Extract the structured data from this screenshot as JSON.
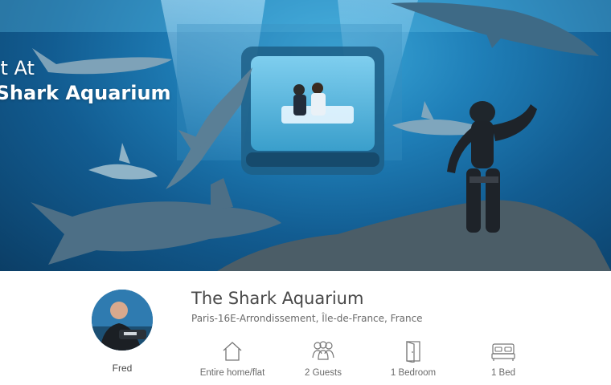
{
  "hero": {
    "title_line1": "ght At",
    "title_line2": "e Shark Aquarium"
  },
  "host": {
    "name": "Fred"
  },
  "listing": {
    "title": "The Shark Aquarium",
    "location": "Paris-16E-Arrondissement, Île-de-France, France"
  },
  "amenities": [
    {
      "icon": "house-icon",
      "label": "Entire home/flat"
    },
    {
      "icon": "guests-icon",
      "label": "2 Guests"
    },
    {
      "icon": "door-icon",
      "label": "1 Bedroom"
    },
    {
      "icon": "bed-icon",
      "label": "1 Bed"
    }
  ],
  "colors": {
    "water_light": "#3aa7d8",
    "water_dark": "#0b3e66",
    "text_primary": "#484848",
    "text_secondary": "#6a6a6a"
  }
}
